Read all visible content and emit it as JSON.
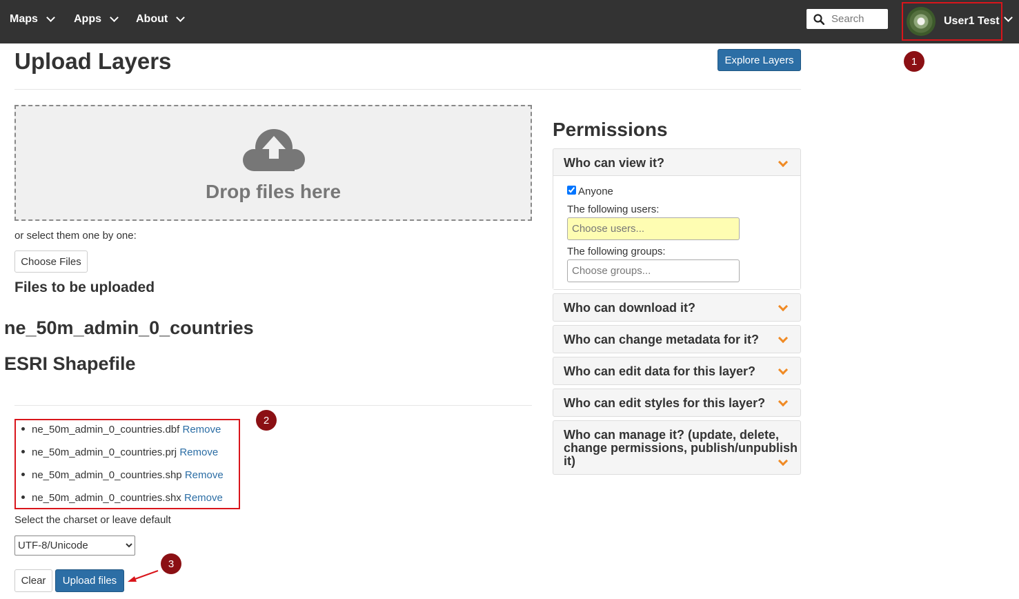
{
  "navbar": {
    "items": [
      {
        "label": "Maps"
      },
      {
        "label": "Apps"
      },
      {
        "label": "About"
      }
    ],
    "search_placeholder": "Search",
    "user_name": "User1 Test"
  },
  "badges": [
    "1",
    "2",
    "3"
  ],
  "page": {
    "title": "Upload Layers",
    "explore_button": "Explore Layers"
  },
  "dropzone": {
    "text": "Drop files here"
  },
  "upload": {
    "select_text": "or select them one by one:",
    "choose_files_button": "Choose Files",
    "files_heading": "Files to be uploaded",
    "layer_name": "ne_50m_admin_0_countries",
    "layer_type": "ESRI Shapefile",
    "files": [
      {
        "name": "ne_50m_admin_0_countries.dbf",
        "action": "Remove"
      },
      {
        "name": "ne_50m_admin_0_countries.prj",
        "action": "Remove"
      },
      {
        "name": "ne_50m_admin_0_countries.shp",
        "action": "Remove"
      },
      {
        "name": "ne_50m_admin_0_countries.shx",
        "action": "Remove"
      }
    ],
    "charset_label": "Select the charset or leave default",
    "charset_value": "UTF-8/Unicode",
    "clear_button": "Clear",
    "upload_button": "Upload files"
  },
  "permissions": {
    "title": "Permissions",
    "panels": [
      {
        "title": "Who can view it?"
      },
      {
        "title": "Who can download it?"
      },
      {
        "title": "Who can change metadata for it?"
      },
      {
        "title": "Who can edit data for this layer?"
      },
      {
        "title": "Who can edit styles for this layer?"
      },
      {
        "title_line1": "Who can manage it? (update, delete,",
        "title_line2": "change permissions, publish/unpublish",
        "title_line3": "it)"
      }
    ],
    "view": {
      "anyone_label": "Anyone",
      "users_label": "The following users:",
      "users_placeholder": "Choose users...",
      "groups_label": "The following groups:",
      "groups_placeholder": "Choose groups..."
    }
  },
  "colors": {
    "navbar": "#333333",
    "primary": "#2c6ea5",
    "highlight_border": "#d9151b",
    "badge": "#8b1014",
    "chevron": "#f08a24"
  }
}
